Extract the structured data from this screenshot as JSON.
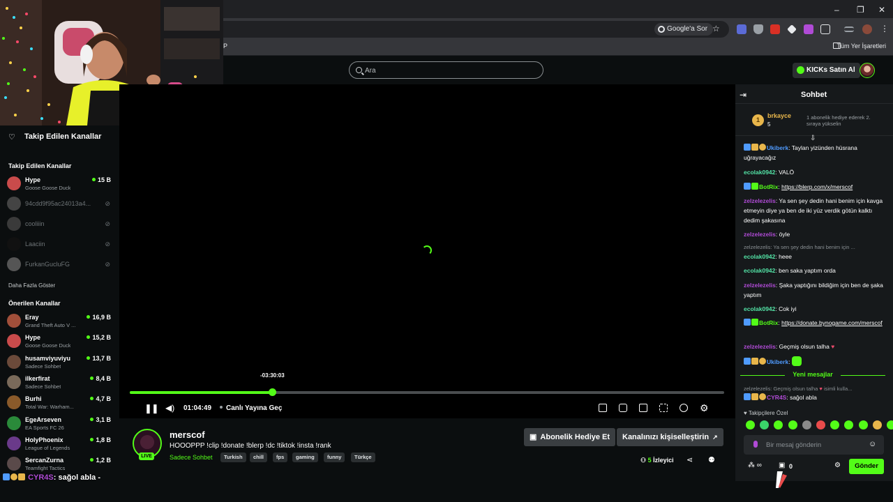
{
  "browser": {
    "google_sor": "Google'a Sor",
    "bookmarks_all": "Tüm Yer İşaretleri",
    "minimize": "–",
    "restore": "❐",
    "close": "✕",
    "star_icon": "☆",
    "kebab": "⋮"
  },
  "header": {
    "search_placeholder": "Ara",
    "kicks_button": "KICKs Satın Al"
  },
  "sidebar": {
    "followed_title": "Takip Edilen Kanallar",
    "followed_section": "Takip Edilen Kanallar",
    "show_more": "Daha Fazla Göster",
    "recommended_section": "Önerilen Kanallar",
    "followed": [
      {
        "name": "Hype",
        "game": "Goose Goose Duck",
        "viewers": "15 B",
        "live": true,
        "color": "#c94b4b"
      },
      {
        "name": "94cdd9f95ac24013a4...",
        "game": "",
        "viewers": "",
        "live": false,
        "color": "#444"
      },
      {
        "name": "cooliiin",
        "game": "",
        "viewers": "",
        "live": false,
        "color": "#3a3a3a"
      },
      {
        "name": "Laaciin",
        "game": "",
        "viewers": "",
        "live": false,
        "color": "#111"
      },
      {
        "name": "FurkanGucluFG",
        "game": "",
        "viewers": "",
        "live": false,
        "color": "#555"
      }
    ],
    "recommended": [
      {
        "name": "Eray",
        "game": "Grand Theft Auto V ...",
        "viewers": "16,9 B",
        "color": "#a14f3a"
      },
      {
        "name": "Hype",
        "game": "Goose Goose Duck",
        "viewers": "15,2 B",
        "color": "#c94b4b"
      },
      {
        "name": "husamviyuviyu",
        "game": "Sadece Sohbet",
        "viewers": "13,7 B",
        "color": "#6b4a3a"
      },
      {
        "name": "ilkerfirat",
        "game": "Sadece Sohbet",
        "viewers": "8,4 B",
        "color": "#7a6a5a"
      },
      {
        "name": "Burhi",
        "game": "Total War: Warham...",
        "viewers": "4,7 B",
        "color": "#8a5a2a"
      },
      {
        "name": "EgeArseven",
        "game": "EA Sports FC 26",
        "viewers": "3,1 B",
        "color": "#2a8a3a"
      },
      {
        "name": "HolyPhoenix",
        "game": "League of Legends",
        "viewers": "1,8 B",
        "color": "#6a3a8a"
      },
      {
        "name": "SercanZurna",
        "game": "Teamfight Tactics",
        "viewers": "1,2 B",
        "color": "#5a4a4a"
      }
    ]
  },
  "player": {
    "tooltip_time": "-03:30:03",
    "current_time": "01:04:49",
    "go_live": "Canlı Yayına Geç",
    "progress": 0.24
  },
  "stream": {
    "channel": "merscof",
    "title": "HOOOPPP   !clip !donate !blerp !dc !tiktok !insta !rank",
    "live_badge": "LIVE",
    "category": "Sadece Sohbet",
    "tags": [
      "Turkish",
      "chill",
      "fps",
      "gaming",
      "funny",
      "Türkçe"
    ],
    "gift_sub": "Abonelik Hediye Et",
    "customize": "Kanalınızı kişiselleştirin",
    "viewers_count": "5",
    "viewers_label": "İzleyici"
  },
  "chat": {
    "title": "Sohbet",
    "pinned_rank": "1",
    "pinned_user": "brkayce",
    "pinned_count": "5",
    "pinned_text": "1 abonelik hediye ederek 2. sıraya yükselin",
    "messages": [
      {
        "user": "Ukiberk",
        "color": "#4f9bff",
        "text": "Taylan yizünden hüsrana uğrayacağız"
      },
      {
        "user": "ecolak0942",
        "color": "#53e3a6",
        "text": "VALÖ"
      },
      {
        "user": "BotRix",
        "color": "#53fc18",
        "text": "https://blerp.com/x/merscof"
      },
      {
        "user": "zelzelezelis",
        "color": "#b04bd6",
        "text": "Ya sen şey dedin hani benim için kavga etmeyin diye ya ben de iki yüz verdik götün kalktı dedim şakasına"
      },
      {
        "user": "zelzelezelis",
        "color": "#b04bd6",
        "text": "öyle"
      },
      {
        "user": "ecolak0942",
        "color": "#53e3a6",
        "text": "heee"
      },
      {
        "user": "ecolak0942",
        "color": "#53e3a6",
        "text": "ben saka yaptım orda"
      },
      {
        "user": "zelzelezelis",
        "color": "#b04bd6",
        "text": "Şaka yaptığını bildiğim için ben de şaka yaptım"
      },
      {
        "user": "ecolak0942",
        "color": "#53e3a6",
        "text": "Cok iyi"
      },
      {
        "user": "BotRix",
        "color": "#53fc18",
        "text": "https://donate.bynogame.com/merscof"
      },
      {
        "user": "zelzelezelis",
        "color": "#b04bd6",
        "text": "Geçmiş olsun talha"
      },
      {
        "user": "Ukiberk",
        "color": "#4f9bff",
        "text": ""
      },
      {
        "user": "CYR4S",
        "color": "#b04bd6",
        "text": "sağol abla"
      }
    ],
    "reply1": "zelzelezelis: Ya sen şey dedin hani benim için ...",
    "reply2": "zelzelezelis: Geçmiş olsun talha",
    "reply2_tail": "isimli kulla...",
    "new_messages": "Yeni mesajlar",
    "followers_special": "Takipçilere Özel",
    "input_placeholder": "Bir mesaj gönderin",
    "send": "Gönder",
    "points": "0"
  },
  "overlay": {
    "user": "CYR4S",
    "text": ": sağol abla -"
  },
  "colors": {
    "accent": "#53fc18",
    "background": "#0b0e0f",
    "chat_bg": "#16191b"
  }
}
